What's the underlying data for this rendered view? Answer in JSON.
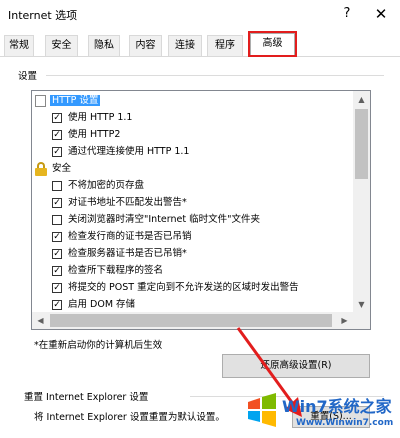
{
  "window": {
    "title": "Internet 选项",
    "help_label": "?",
    "close_label": "✕"
  },
  "tabs": [
    {
      "label": "常规"
    },
    {
      "label": "安全"
    },
    {
      "label": "隐私"
    },
    {
      "label": "内容"
    },
    {
      "label": "连接"
    },
    {
      "label": "程序"
    },
    {
      "label": "高级",
      "active": true
    }
  ],
  "settings": {
    "label": "设置",
    "groups": [
      {
        "title": "HTTP 设置",
        "icon": "document-icon",
        "items": [
          {
            "label": "使用 HTTP 1.1",
            "checked": true
          },
          {
            "label": "使用 HTTP2",
            "checked": true
          },
          {
            "label": "通过代理连接使用 HTTP 1.1",
            "checked": true
          }
        ]
      },
      {
        "title": "安全",
        "icon": "lock-icon",
        "items": [
          {
            "label": "不将加密的页存盘",
            "checked": false
          },
          {
            "label": "对证书地址不匹配发出警告*",
            "checked": true
          },
          {
            "label": "关闭浏览器时清空\"Internet 临时文件\"文件夹",
            "checked": false
          },
          {
            "label": "检查发行商的证书是否已吊销",
            "checked": true
          },
          {
            "label": "检查服务器证书是否已吊销*",
            "checked": true
          },
          {
            "label": "检查所下载程序的签名",
            "checked": true
          },
          {
            "label": "将提交的 POST 重定向到不允许发送的区域时发出警告",
            "checked": true
          },
          {
            "label": "启用 DOM 存储",
            "checked": true
          }
        ]
      }
    ],
    "scroll_up": "▲",
    "scroll_down": "▼",
    "scroll_left": "◀",
    "scroll_right": "▶",
    "note": "*在重新启动你的计算机后生效",
    "restore_button": "还原高级设置(R)"
  },
  "reset": {
    "label": "重置 Internet Explorer 设置",
    "description": "将 Internet Explorer 设置重置为默认设置。",
    "button": "重置(S)..."
  },
  "watermark": {
    "text": "Win7系统之家",
    "url": "Www.Winwin7.com"
  },
  "colors": {
    "highlight": "#3399ff",
    "annotation_red": "#e21d1d",
    "watermark_blue": "#2167c7"
  }
}
